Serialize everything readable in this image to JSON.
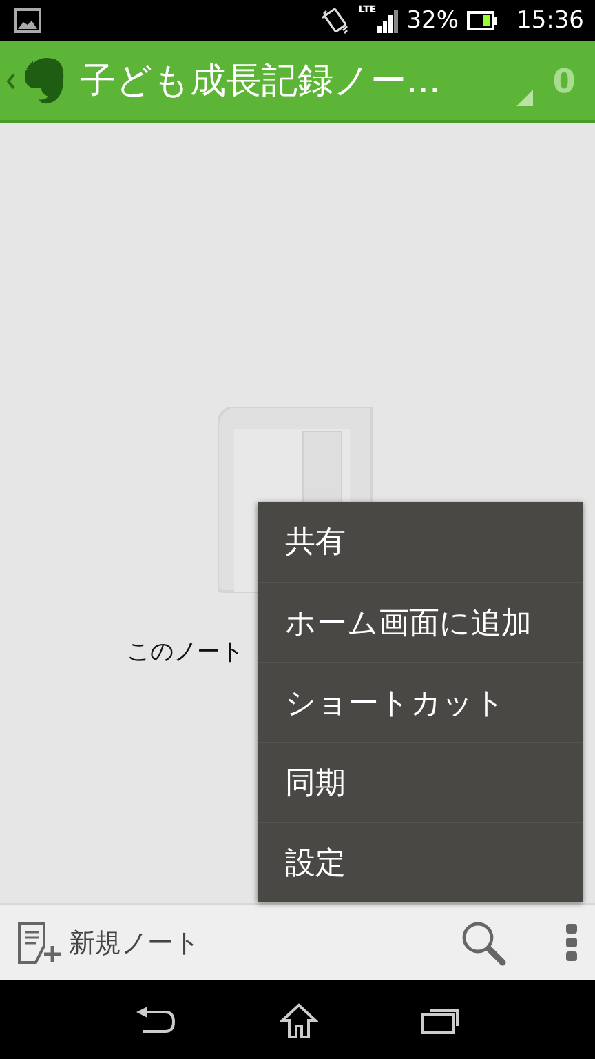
{
  "status_bar": {
    "battery_text": "32%",
    "time": "15:36",
    "network": "LTE"
  },
  "header": {
    "title": "子ども成長記録ノー...",
    "count": "0"
  },
  "empty_state": {
    "message": "このノート"
  },
  "menu": {
    "items": [
      {
        "label": "共有"
      },
      {
        "label": "ホーム画面に追加"
      },
      {
        "label": "ショートカット"
      },
      {
        "label": "同期"
      },
      {
        "label": "設定"
      }
    ]
  },
  "bottom_bar": {
    "new_note": "新規ノート"
  }
}
